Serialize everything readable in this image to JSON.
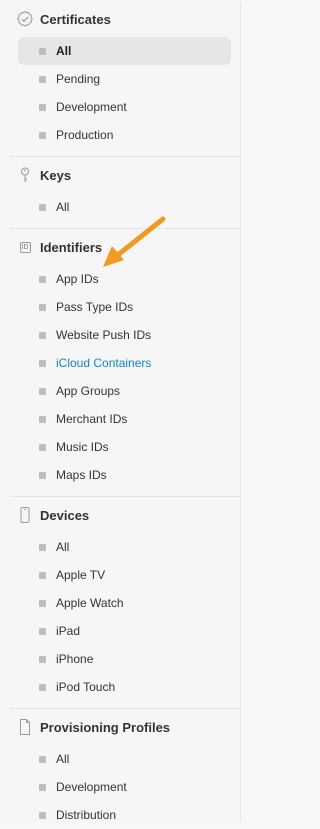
{
  "sections": [
    {
      "title": "Certificates",
      "icon": "certificate-badge-icon",
      "items": [
        {
          "label": "All",
          "active": true
        },
        {
          "label": "Pending"
        },
        {
          "label": "Development"
        },
        {
          "label": "Production"
        }
      ]
    },
    {
      "title": "Keys",
      "icon": "key-icon",
      "items": [
        {
          "label": "All"
        }
      ]
    },
    {
      "title": "Identifiers",
      "icon": "id-icon",
      "icon_text": "ID",
      "items": [
        {
          "label": "App IDs"
        },
        {
          "label": "Pass Type IDs"
        },
        {
          "label": "Website Push IDs"
        },
        {
          "label": "iCloud Containers",
          "link": true
        },
        {
          "label": "App Groups"
        },
        {
          "label": "Merchant IDs"
        },
        {
          "label": "Music IDs"
        },
        {
          "label": "Maps IDs"
        }
      ]
    },
    {
      "title": "Devices",
      "icon": "device-icon",
      "items": [
        {
          "label": "All"
        },
        {
          "label": "Apple TV"
        },
        {
          "label": "Apple Watch"
        },
        {
          "label": "iPad"
        },
        {
          "label": "iPhone"
        },
        {
          "label": "iPod Touch"
        }
      ]
    },
    {
      "title": "Provisioning Profiles",
      "icon": "document-icon",
      "items": [
        {
          "label": "All"
        },
        {
          "label": "Development"
        },
        {
          "label": "Distribution"
        }
      ]
    }
  ],
  "colors": {
    "link": "#0e86c6",
    "annotation_arrow": "#f29a1f",
    "active_bg": "#e6e6e6"
  }
}
